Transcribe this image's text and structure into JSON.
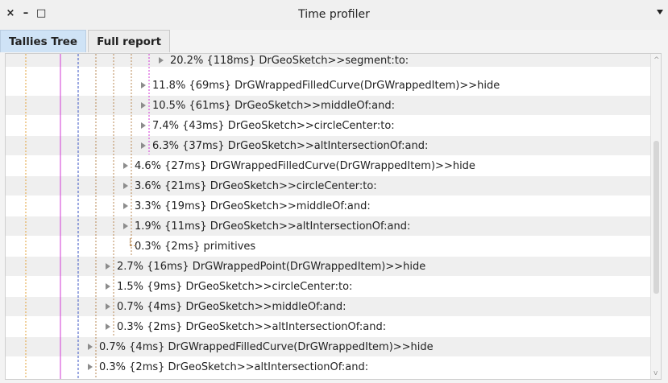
{
  "window": {
    "title": "Time profiler",
    "controls": [
      "×",
      "–",
      "□"
    ]
  },
  "tabs": [
    {
      "label": "Tallies Tree",
      "active": true
    },
    {
      "label": "Full report",
      "active": false
    }
  ],
  "colors": {
    "accent_tab": "#cfe3f6",
    "guide_orange": "#e3a23a",
    "guide_magenta": "#d23ad6",
    "guide_blue": "#3b54c4",
    "guide_brown": "#b88a55"
  },
  "tree": {
    "rows": [
      {
        "text": "20.2% {118ms} DrGeoSketch>>segment:to:",
        "expander": "triangle-right"
      },
      {
        "text": "11.8% {69ms} DrGWrappedFilledCurve(DrGWrappedItem)>>hide",
        "expander": "triangle-right"
      },
      {
        "text": "10.5% {61ms} DrGeoSketch>>middleOf:and:",
        "expander": "triangle-right"
      },
      {
        "text": "7.4% {43ms} DrGeoSketch>>circleCenter:to:",
        "expander": "triangle-right"
      },
      {
        "text": "6.3% {37ms} DrGeoSketch>>altIntersectionOf:and:",
        "expander": "triangle-right"
      },
      {
        "text": "4.6% {27ms} DrGWrappedFilledCurve(DrGWrappedItem)>>hide",
        "expander": "triangle-right"
      },
      {
        "text": "3.6% {21ms} DrGeoSketch>>circleCenter:to:",
        "expander": "triangle-right"
      },
      {
        "text": "3.3% {19ms} DrGeoSketch>>middleOf:and:",
        "expander": "triangle-right"
      },
      {
        "text": "1.9% {11ms} DrGeoSketch>>altIntersectionOf:and:",
        "expander": "triangle-right"
      },
      {
        "text": "0.3% {2ms} primitives",
        "expander": "none"
      },
      {
        "text": "2.7% {16ms} DrGWrappedPoint(DrGWrappedItem)>>hide",
        "expander": "triangle-right"
      },
      {
        "text": "1.5% {9ms} DrGeoSketch>>circleCenter:to:",
        "expander": "triangle-right"
      },
      {
        "text": "0.7% {4ms} DrGeoSketch>>middleOf:and:",
        "expander": "triangle-right"
      },
      {
        "text": "0.3% {2ms} DrGeoSketch>>altIntersectionOf:and:",
        "expander": "triangle-right"
      },
      {
        "text": "0.7% {4ms} DrGWrappedFilledCurve(DrGWrappedItem)>>hide",
        "expander": "triangle-right"
      },
      {
        "text": "0.3% {2ms} DrGeoSketch>>altIntersectionOf:and:",
        "expander": "triangle-right"
      }
    ]
  },
  "scrollbar": {
    "up_icon": "^",
    "down_icon": "v"
  }
}
